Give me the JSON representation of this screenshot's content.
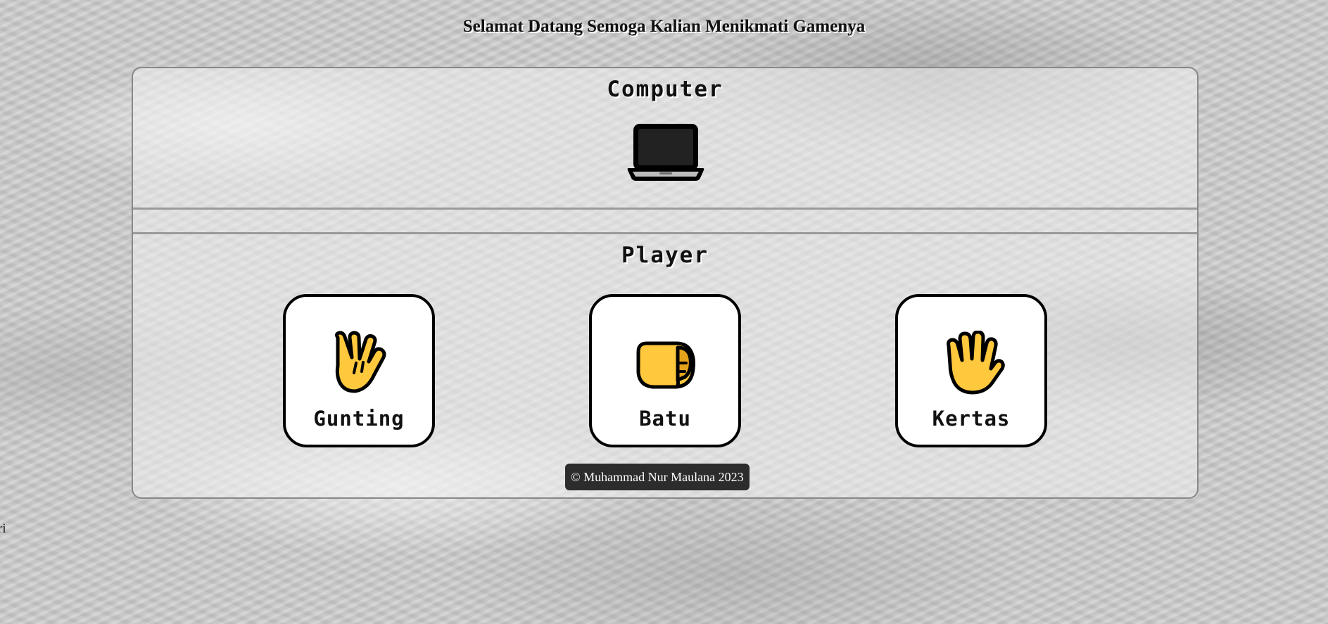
{
  "header": {
    "title": "Selamat Datang Semoga Kalian Menikmati Gamenya"
  },
  "computer": {
    "heading": "Computer",
    "icon": "laptop-icon"
  },
  "player": {
    "heading": "Player",
    "choices": [
      {
        "label": "Gunting",
        "icon": "vulcan-salute-hand-icon"
      },
      {
        "label": "Batu",
        "icon": "fist-icon"
      },
      {
        "label": "Kertas",
        "icon": "raised-hand-icon"
      }
    ]
  },
  "footer": {
    "copyright": "© Muhammad Nur Maulana 2023"
  },
  "edge_text": "ri",
  "colors": {
    "panel_border": "#888888",
    "card_border": "#000000",
    "emoji_yellow": "#FFC83D",
    "footer_bg": "#2C2C2C"
  }
}
